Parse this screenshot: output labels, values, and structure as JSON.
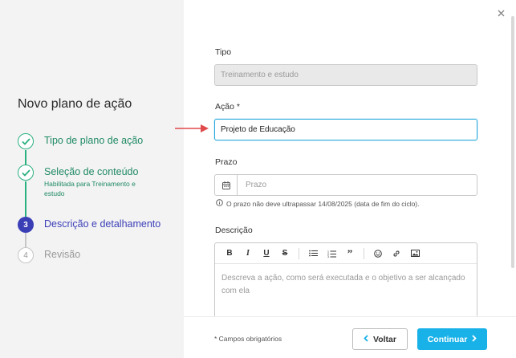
{
  "sidebar": {
    "title": "Novo plano de ação",
    "steps": [
      {
        "number": "1",
        "label": "Tipo de plano de ação",
        "state": "done"
      },
      {
        "number": "2",
        "label": "Seleção de conteúdo",
        "sub": "Habilitada para Treinamento e estudo",
        "state": "done"
      },
      {
        "number": "3",
        "label": "Descrição e detalhamento",
        "state": "active"
      },
      {
        "number": "4",
        "label": "Revisão",
        "state": "todo"
      }
    ]
  },
  "form": {
    "tipo": {
      "label": "Tipo",
      "value": "Treinamento e estudo"
    },
    "acao": {
      "label": "Ação *",
      "value": "Projeto de Educação"
    },
    "prazo": {
      "label": "Prazo",
      "placeholder": "Prazo",
      "hint": "O prazo não deve ultrapassar 14/08/2025 (data de fim do ciclo)."
    },
    "descricao": {
      "label": "Descrição",
      "placeholder": "Descreva a ação, como será executada e o objetivo a ser alcançado com ela",
      "toolbar": [
        "bold-icon",
        "italic-icon",
        "underline-icon",
        "strikethrough-icon",
        "bullet-list-icon",
        "numbered-list-icon",
        "quote-icon",
        "emoji-icon",
        "link-icon",
        "image-icon"
      ]
    }
  },
  "footer": {
    "required_note": "* Campos obrigatórios",
    "back_label": "Voltar",
    "next_label": "Continuar"
  },
  "colors": {
    "done": "#2bb07f",
    "active": "#3b3fb6",
    "primary_button": "#19b2e8",
    "focus_border": "#29a9dc",
    "arrow": "#e04a4a"
  }
}
